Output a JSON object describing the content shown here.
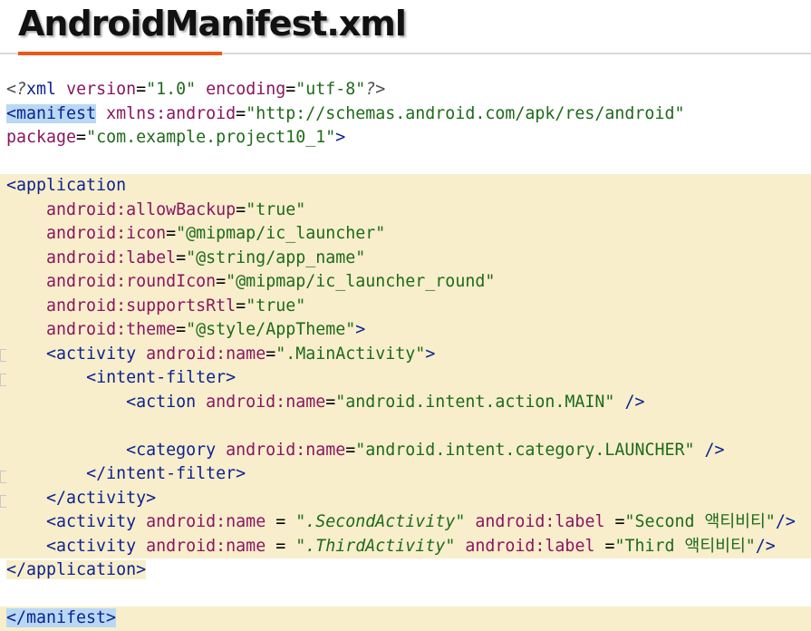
{
  "title": "AndroidManifest.xml",
  "colors": {
    "accent_rule": "#e9581b",
    "highlight": "#f8eecb",
    "selection": "#b9d8f3",
    "tag": "#0b2290",
    "attribute": "#8b1560",
    "value": "#1e6a1a"
  },
  "code": {
    "xml_decl": {
      "open": "<?",
      "name": "xml",
      "version_attr": "version",
      "version_val": "\"1.0\"",
      "encoding_attr": "encoding",
      "encoding_val": "\"utf-8\"",
      "close": "?>"
    },
    "manifest_open": {
      "tag": "<manifest",
      "xmlns_prefix": "xmlns:",
      "xmlns_name": "android",
      "xmlns_val": "\"http://schemas.android.com/apk/res/android\"",
      "package_attr": "package",
      "package_val": "\"com.example.project10_1\"",
      "close": ">"
    },
    "application_open": "<application",
    "app_attrs": [
      {
        "ns": "android:",
        "name": "allowBackup",
        "val": "\"true\""
      },
      {
        "ns": "android:",
        "name": "icon",
        "val": "\"@mipmap/ic_launcher\""
      },
      {
        "ns": "android:",
        "name": "label",
        "val": "\"@string/app_name\""
      },
      {
        "ns": "android:",
        "name": "roundIcon",
        "val": "\"@mipmap/ic_launcher_round\""
      },
      {
        "ns": "android:",
        "name": "supportsRtl",
        "val": "\"true\""
      },
      {
        "ns": "android:",
        "name": "theme",
        "val": "\"@style/AppTheme\"",
        "close": ">"
      }
    ],
    "main_activity": {
      "tag": "<activity",
      "ns": "android:",
      "name_attr": "name",
      "name_val": "\".MainActivity\"",
      "close": ">"
    },
    "intent_filter_open": "<intent-filter>",
    "action": {
      "tag": "<action",
      "ns": "android:",
      "name_attr": "name",
      "name_val": "\"android.intent.action.MAIN\"",
      "close": "/>"
    },
    "category": {
      "tag": "<category",
      "ns": "android:",
      "name_attr": "name",
      "name_val": "\"android.intent.category.LAUNCHER\"",
      "close": "/>"
    },
    "intent_filter_close": "</intent-filter>",
    "activity_close": "</activity>",
    "second_activity": {
      "tag": "<activity",
      "ns": "android:",
      "name_attr": "name",
      "eq": " = ",
      "name_val": "\".SecondActivity\"",
      "ns2": "android:",
      "label_attr": "label",
      "eq2": " =",
      "label_val": "\"Second 액티비티\"",
      "close": "/>"
    },
    "third_activity": {
      "tag": "<activity",
      "ns": "android:",
      "name_attr": "name",
      "eq": " = ",
      "name_val": "\".ThirdActivity\"",
      "ns2": "android:",
      "label_attr": "label",
      "eq2": " =",
      "label_val": "\"Third 액티비티\"",
      "close": "/>"
    },
    "application_close": "</application>",
    "manifest_close": "</manifest>"
  }
}
